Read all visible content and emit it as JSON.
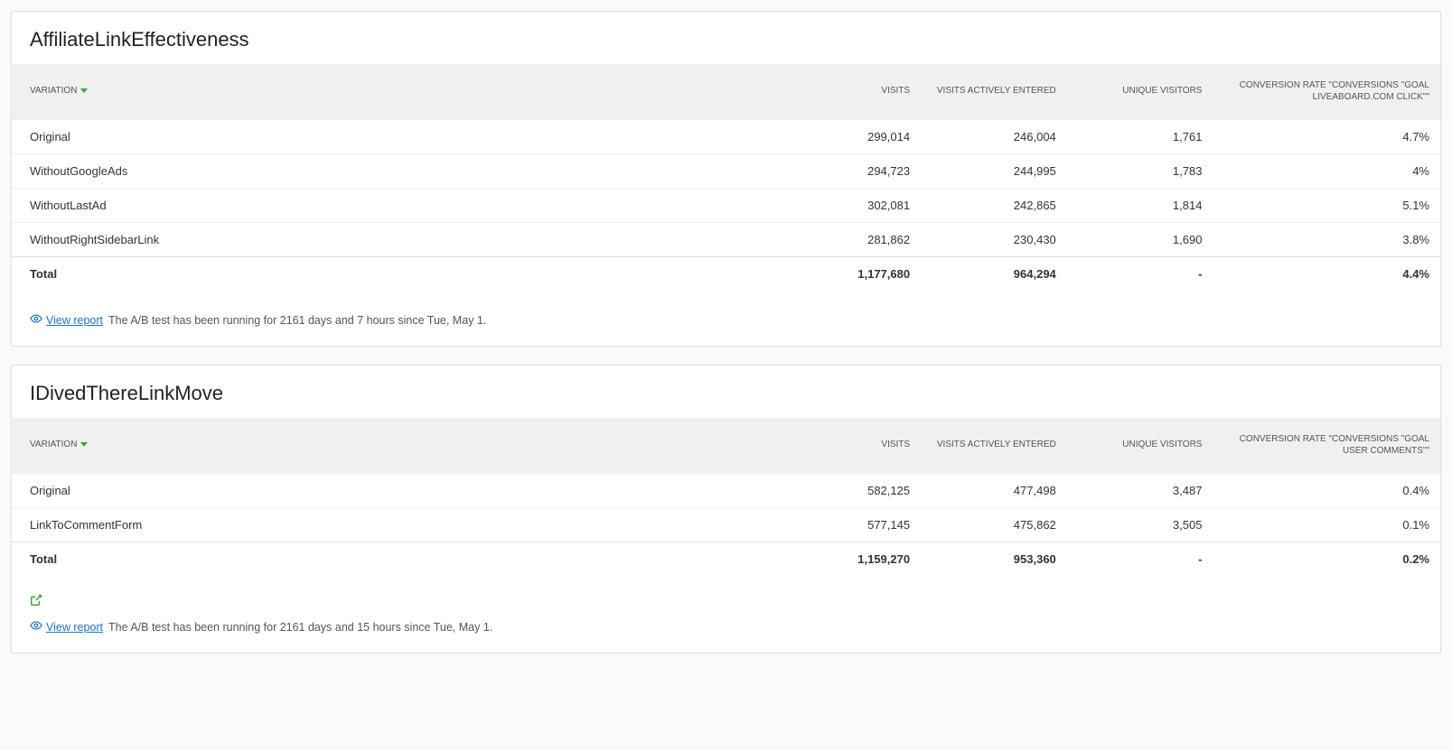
{
  "panels": [
    {
      "title": "AffiliateLinkEffectiveness",
      "headers": {
        "variation": "VARIATION",
        "visits": "VISITS",
        "visits_entered": "VISITS ACTIVELY ENTERED",
        "unique": "UNIQUE VISITORS",
        "conv": "CONVERSION RATE \"CONVERSIONS \"GOAL LIVEABOARD.COM CLICK\"\""
      },
      "rows": [
        {
          "variation": "Original",
          "visits": "299,014",
          "entered": "246,004",
          "unique": "1,761",
          "conv": "4.7%"
        },
        {
          "variation": "WithoutGoogleAds",
          "visits": "294,723",
          "entered": "244,995",
          "unique": "1,783",
          "conv": "4%"
        },
        {
          "variation": "WithoutLastAd",
          "visits": "302,081",
          "entered": "242,865",
          "unique": "1,814",
          "conv": "5.1%"
        },
        {
          "variation": "WithoutRightSidebarLink",
          "visits": "281,862",
          "entered": "230,430",
          "unique": "1,690",
          "conv": "3.8%"
        }
      ],
      "total": {
        "variation": "Total",
        "visits": "1,177,680",
        "entered": "964,294",
        "unique": "-",
        "conv": "4.4%"
      },
      "show_export": false,
      "view_report_label": "View report",
      "status": "The A/B test has been running for 2161 days and 7 hours since Tue, May 1."
    },
    {
      "title": "IDivedThereLinkMove",
      "headers": {
        "variation": "VARIATION",
        "visits": "VISITS",
        "visits_entered": "VISITS ACTIVELY ENTERED",
        "unique": "UNIQUE VISITORS",
        "conv": "CONVERSION RATE \"CONVERSIONS \"GOAL USER COMMENTS\"\""
      },
      "rows": [
        {
          "variation": "Original",
          "visits": "582,125",
          "entered": "477,498",
          "unique": "3,487",
          "conv": "0.4%"
        },
        {
          "variation": "LinkToCommentForm",
          "visits": "577,145",
          "entered": "475,862",
          "unique": "3,505",
          "conv": "0.1%"
        }
      ],
      "total": {
        "variation": "Total",
        "visits": "1,159,270",
        "entered": "953,360",
        "unique": "-",
        "conv": "0.2%"
      },
      "show_export": true,
      "view_report_label": "View report",
      "status": "The A/B test has been running for 2161 days and 15 hours since Tue, May 1."
    }
  ]
}
